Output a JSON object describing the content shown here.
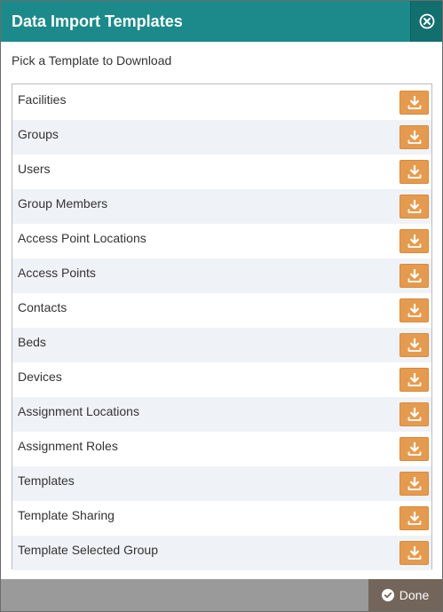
{
  "dialog": {
    "title": "Data Import Templates",
    "close_icon": "close-circle-icon",
    "subtitle": "Pick a Template to Download",
    "templates": [
      {
        "label": "Facilities"
      },
      {
        "label": "Groups"
      },
      {
        "label": "Users"
      },
      {
        "label": "Group Members"
      },
      {
        "label": "Access Point Locations"
      },
      {
        "label": "Access Points"
      },
      {
        "label": "Contacts"
      },
      {
        "label": "Beds"
      },
      {
        "label": "Devices"
      },
      {
        "label": "Assignment Locations"
      },
      {
        "label": "Assignment Roles"
      },
      {
        "label": "Templates"
      },
      {
        "label": "Template Sharing"
      },
      {
        "label": "Template Selected Group"
      }
    ],
    "download_icon": "download-tray-icon",
    "done_label": "Done",
    "done_icon": "check-circle-icon"
  },
  "colors": {
    "header": "#1c8a8a",
    "close_button": "#136e6e",
    "download_button": "#e59b4f",
    "footer": "#9a9a9a",
    "done_button": "#74655a",
    "row_alt": "#eff3f7"
  }
}
